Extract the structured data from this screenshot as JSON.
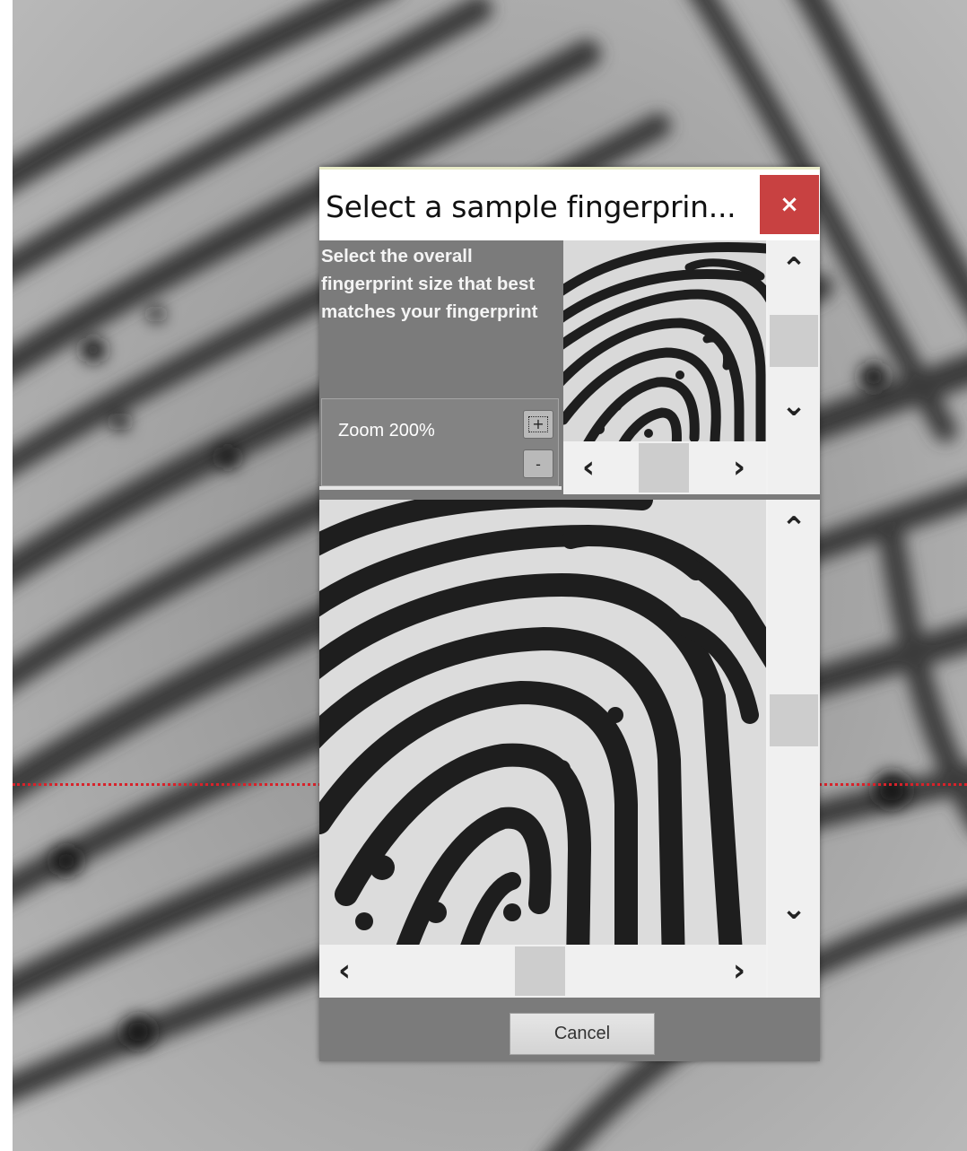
{
  "dialog": {
    "title": "Select a sample fingerprin...",
    "close_label": "×",
    "instruction": "Select the overall fingerprint size that best matches your fingerprint",
    "zoom": {
      "label": "Zoom 200%",
      "zoom_in_label": "+",
      "zoom_out_label": "-"
    },
    "cancel_label": "Cancel"
  },
  "icons": {
    "scroll_up": "chevron-up-icon",
    "scroll_down": "chevron-down-icon",
    "scroll_left": "chevron-left-icon",
    "scroll_right": "chevron-right-icon"
  },
  "colors": {
    "close_button": "#c84141",
    "dialog_body": "#7b7b7b",
    "guide_line": "#d8222a"
  }
}
